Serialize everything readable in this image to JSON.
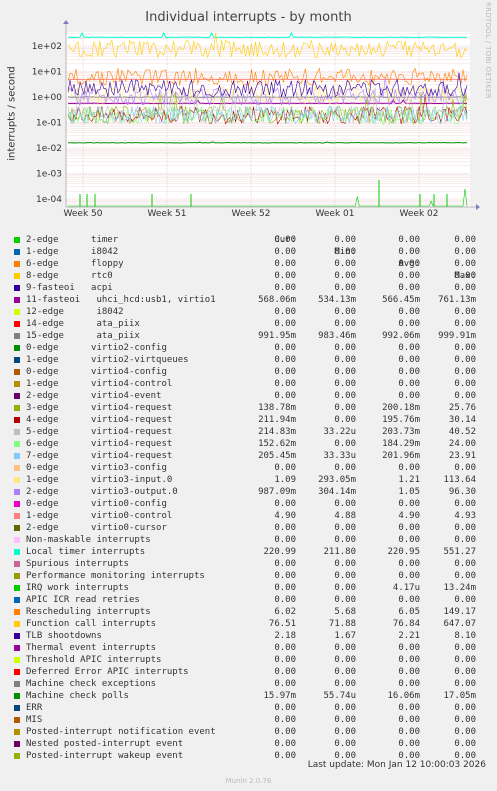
{
  "title": "Individual interrupts - by month",
  "side_text": "RRDTOOL / TOBI OETIKER",
  "footer": "Last update: Mon Jan 12 10:00:03 2026",
  "version": "Munin 2.0.76",
  "legend_headers": {
    "cur": "Cur:",
    "min": "Min:",
    "avg": "Avg:",
    "max": "Max:"
  },
  "chart_data": {
    "type": "line",
    "title": "Individual interrupts - by month",
    "ylabel": "interrupts / second",
    "yscale": "log",
    "ylim": [
      5e-05,
      500
    ],
    "y_ticks": [
      "1e+02",
      "1e+01",
      "1e+00",
      "1e-01",
      "1e-02",
      "1e-03",
      "1e-04"
    ],
    "x_ticks": [
      "Week 50",
      "Week 51",
      "Week 52",
      "Week 01",
      "Week 02"
    ],
    "grid": true,
    "series": [
      {
        "name": "2-edge      timer",
        "color": "#00cc00",
        "cur": "0.00",
        "min": "0.00",
        "avg": "0.00",
        "max": "0.00"
      },
      {
        "name": "1-edge      i8042",
        "color": "#0066b3",
        "cur": "0.00",
        "min": "0.00",
        "avg": "0.00",
        "max": "0.00"
      },
      {
        "name": "6-edge      floppy",
        "color": "#ff8000",
        "cur": "0.00",
        "min": "0.00",
        "avg": "0.00",
        "max": "0.00"
      },
      {
        "name": "8-edge      rtc0",
        "color": "#ffcc00",
        "cur": "0.00",
        "min": "0.00",
        "avg": "0.00",
        "max": "0.00"
      },
      {
        "name": "9-fasteoi   acpi",
        "color": "#330099",
        "cur": "0.00",
        "min": "0.00",
        "avg": "0.00",
        "max": "0.00"
      },
      {
        "name": "11-fasteoi   uhci_hcd:usb1, virtio1",
        "color": "#990099",
        "cur": "568.06m",
        "min": "534.13m",
        "avg": "566.45m",
        "max": "761.13m"
      },
      {
        "name": "12-edge      i8042",
        "color": "#ccff00",
        "cur": "0.00",
        "min": "0.00",
        "avg": "0.00",
        "max": "0.00"
      },
      {
        "name": "14-edge      ata_piix",
        "color": "#ff0000",
        "cur": "0.00",
        "min": "0.00",
        "avg": "0.00",
        "max": "0.00"
      },
      {
        "name": "15-edge      ata_piix",
        "color": "#808080",
        "cur": "991.95m",
        "min": "983.46m",
        "avg": "992.06m",
        "max": "999.91m"
      },
      {
        "name": "0-edge      virtio2-config",
        "color": "#008f00",
        "cur": "0.00",
        "min": "0.00",
        "avg": "0.00",
        "max": "0.00"
      },
      {
        "name": "1-edge      virtio2-virtqueues",
        "color": "#00487d",
        "cur": "0.00",
        "min": "0.00",
        "avg": "0.00",
        "max": "0.00"
      },
      {
        "name": "0-edge      virtio4-config",
        "color": "#b35a00",
        "cur": "0.00",
        "min": "0.00",
        "avg": "0.00",
        "max": "0.00"
      },
      {
        "name": "1-edge      virtio4-control",
        "color": "#b38f00",
        "cur": "0.00",
        "min": "0.00",
        "avg": "0.00",
        "max": "0.00"
      },
      {
        "name": "2-edge      virtio4-event",
        "color": "#6b006b",
        "cur": "0.00",
        "min": "0.00",
        "avg": "0.00",
        "max": "0.00"
      },
      {
        "name": "3-edge      virtio4-request",
        "color": "#8fb300",
        "cur": "138.78m",
        "min": "0.00",
        "avg": "200.18m",
        "max": "25.76"
      },
      {
        "name": "4-edge      virtio4-request",
        "color": "#b30000",
        "cur": "211.94m",
        "min": "0.00",
        "avg": "195.76m",
        "max": "30.14"
      },
      {
        "name": "5-edge      virtio4-request",
        "color": "#bebebe",
        "cur": "214.83m",
        "min": "33.22u",
        "avg": "203.73m",
        "max": "40.52"
      },
      {
        "name": "6-edge      virtio4-request",
        "color": "#80ff80",
        "cur": "152.62m",
        "min": "0.00",
        "avg": "184.29m",
        "max": "24.00"
      },
      {
        "name": "7-edge      virtio4-request",
        "color": "#80c9ff",
        "cur": "205.45m",
        "min": "33.33u",
        "avg": "201.96m",
        "max": "23.91"
      },
      {
        "name": "0-edge      virtio3-config",
        "color": "#ffc080",
        "cur": "0.00",
        "min": "0.00",
        "avg": "0.00",
        "max": "0.00"
      },
      {
        "name": "1-edge      virtio3-input.0",
        "color": "#ffe680",
        "cur": "1.09",
        "min": "293.05m",
        "avg": "1.21",
        "max": "113.64"
      },
      {
        "name": "2-edge      virtio3-output.0",
        "color": "#aa80ff",
        "cur": "987.09m",
        "min": "304.14m",
        "avg": "1.05",
        "max": "96.30"
      },
      {
        "name": "0-edge      virtio0-config",
        "color": "#ee00cc",
        "cur": "0.00",
        "min": "0.00",
        "avg": "0.00",
        "max": "0.00"
      },
      {
        "name": "1-edge      virtio0-control",
        "color": "#ff8080",
        "cur": "4.90",
        "min": "4.88",
        "avg": "4.90",
        "max": "4.93"
      },
      {
        "name": "2-edge      virtio0-cursor",
        "color": "#666600",
        "cur": "0.00",
        "min": "0.00",
        "avg": "0.00",
        "max": "0.00"
      },
      {
        "name": "Non-maskable interrupts",
        "color": "#ffbfff",
        "cur": "0.00",
        "min": "0.00",
        "avg": "0.00",
        "max": "0.00"
      },
      {
        "name": "Local timer interrupts",
        "color": "#00ffcc",
        "cur": "220.99",
        "min": "211.80",
        "avg": "220.95",
        "max": "551.27"
      },
      {
        "name": "Spurious interrupts",
        "color": "#cc6699",
        "cur": "0.00",
        "min": "0.00",
        "avg": "0.00",
        "max": "0.00"
      },
      {
        "name": "Performance monitoring interrupts",
        "color": "#999900",
        "cur": "0.00",
        "min": "0.00",
        "avg": "0.00",
        "max": "0.00"
      },
      {
        "name": "IRQ work interrupts",
        "color": "#00cc00",
        "cur": "0.00",
        "min": "0.00",
        "avg": "4.17u",
        "max": "13.24m"
      },
      {
        "name": "APIC ICR read retries",
        "color": "#0066b3",
        "cur": "0.00",
        "min": "0.00",
        "avg": "0.00",
        "max": "0.00"
      },
      {
        "name": "Rescheduling interrupts",
        "color": "#ff8000",
        "cur": "6.02",
        "min": "5.68",
        "avg": "6.05",
        "max": "149.17"
      },
      {
        "name": "Function call interrupts",
        "color": "#ffcc00",
        "cur": "76.51",
        "min": "71.88",
        "avg": "76.84",
        "max": "647.07"
      },
      {
        "name": "TLB shootdowns",
        "color": "#330099",
        "cur": "2.18",
        "min": "1.67",
        "avg": "2.21",
        "max": "8.10"
      },
      {
        "name": "Thermal event interrupts",
        "color": "#990099",
        "cur": "0.00",
        "min": "0.00",
        "avg": "0.00",
        "max": "0.00"
      },
      {
        "name": "Threshold APIC interrupts",
        "color": "#ccff00",
        "cur": "0.00",
        "min": "0.00",
        "avg": "0.00",
        "max": "0.00"
      },
      {
        "name": "Deferred Error APIC interrupts",
        "color": "#ff0000",
        "cur": "0.00",
        "min": "0.00",
        "avg": "0.00",
        "max": "0.00"
      },
      {
        "name": "Machine check exceptions",
        "color": "#808080",
        "cur": "0.00",
        "min": "0.00",
        "avg": "0.00",
        "max": "0.00"
      },
      {
        "name": "Machine check polls",
        "color": "#008f00",
        "cur": "15.97m",
        "min": "55.74u",
        "avg": "16.06m",
        "max": "17.05m"
      },
      {
        "name": "ERR",
        "color": "#00487d",
        "cur": "0.00",
        "min": "0.00",
        "avg": "0.00",
        "max": "0.00"
      },
      {
        "name": "MIS",
        "color": "#b35a00",
        "cur": "0.00",
        "min": "0.00",
        "avg": "0.00",
        "max": "0.00"
      },
      {
        "name": "Posted-interrupt notification event",
        "color": "#b38f00",
        "cur": "0.00",
        "min": "0.00",
        "avg": "0.00",
        "max": "0.00"
      },
      {
        "name": "Nested posted-interrupt event",
        "color": "#6b006b",
        "cur": "0.00",
        "min": "0.00",
        "avg": "0.00",
        "max": "0.00"
      },
      {
        "name": "Posted-interrupt wakeup event",
        "color": "#8fb300",
        "cur": "0.00",
        "min": "0.00",
        "avg": "0.00",
        "max": "0.00"
      }
    ]
  }
}
